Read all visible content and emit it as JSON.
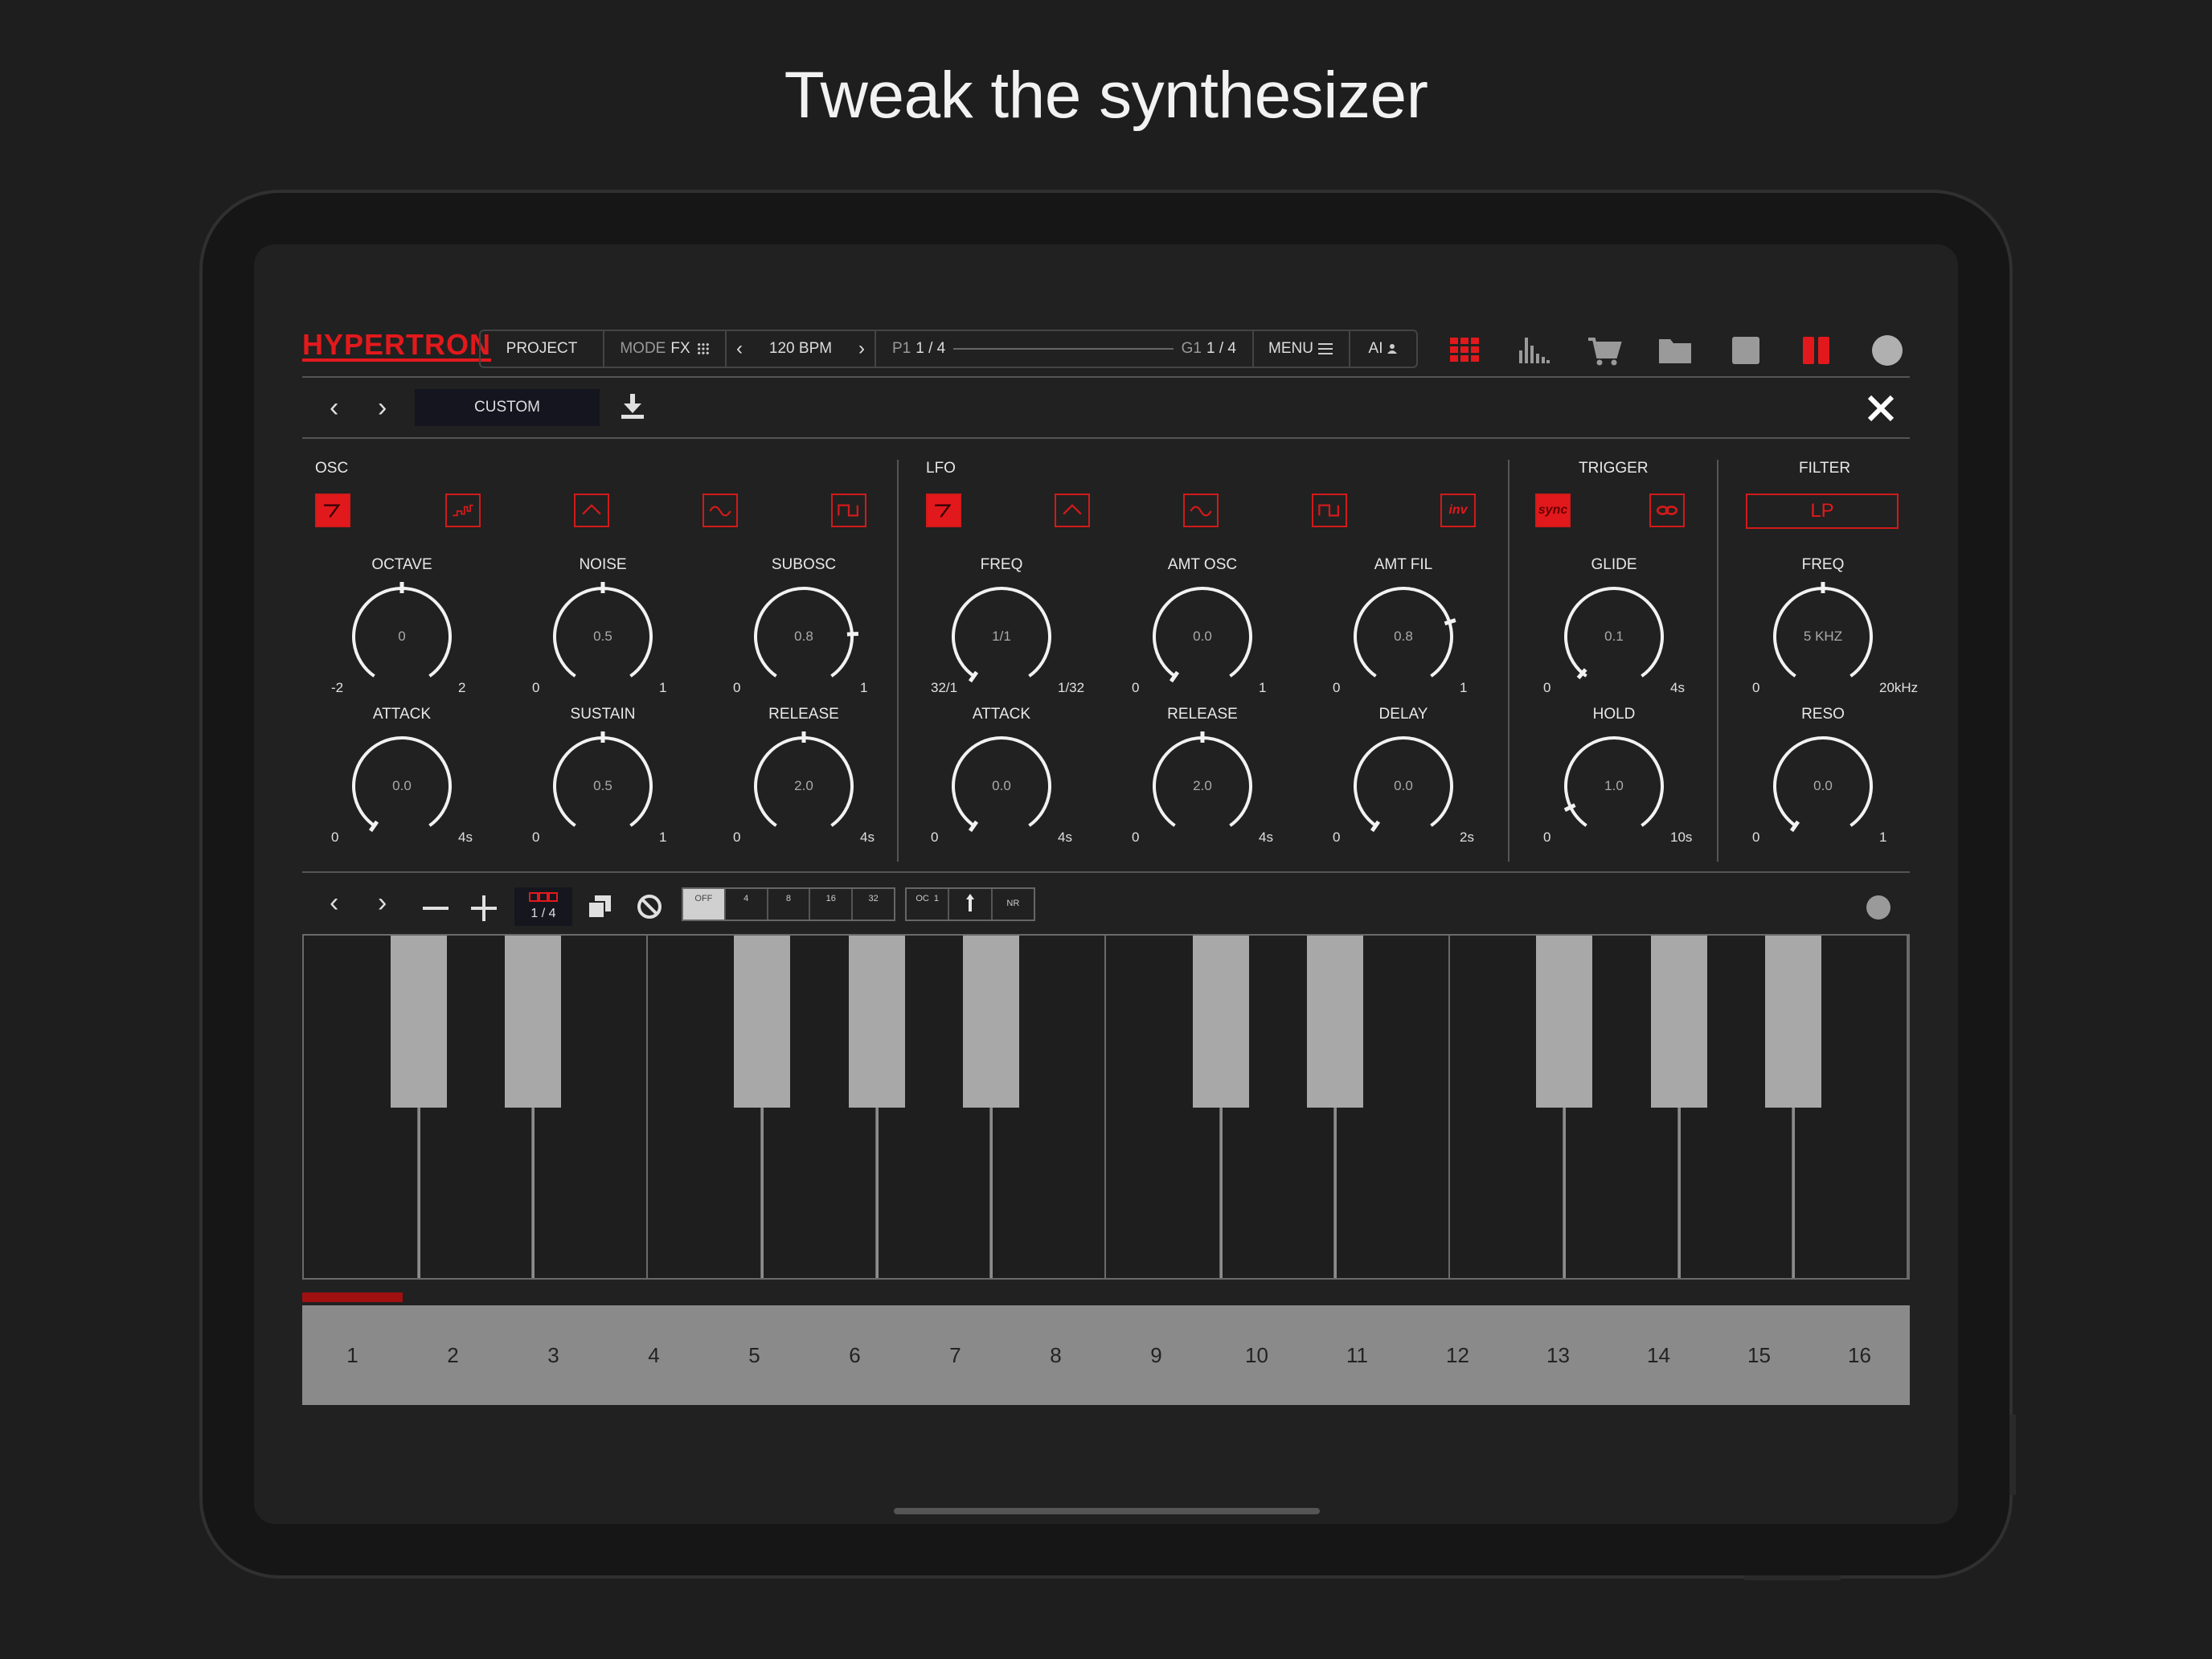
{
  "headline": "Tweak the synthesizer",
  "colors": {
    "accent": "#e2191c",
    "background": "#212121",
    "step_bar": "#8a8a8a",
    "black_key": "#a8a8a8"
  },
  "app": {
    "logo": "HYPERTRON"
  },
  "nav": {
    "project": "PROJECT",
    "mode_label": "MODE",
    "mode_value": "FX",
    "bpm": "120 BPM",
    "pattern_label": "P1",
    "pattern_value": "1 / 4",
    "group_label": "G1",
    "group_value": "1 / 4",
    "menu": "MENU",
    "ai": "AI"
  },
  "top_icons": [
    "grid-icon",
    "mixer-icon",
    "cart-icon",
    "folder-icon",
    "stop-icon",
    "pause-icon",
    "record-icon"
  ],
  "preset": {
    "name": "CUSTOM"
  },
  "sections": {
    "osc": "OSC",
    "lfo": "LFO",
    "trigger": "TRIGGER",
    "filter": "FILTER",
    "filter_type": "LP",
    "sync": "sync",
    "inv": "inv"
  },
  "knobs": [
    {
      "title": "OCTAVE",
      "value": "0",
      "min": "-2",
      "max": "2",
      "level": 0.5
    },
    {
      "title": "NOISE",
      "value": "0.5",
      "min": "0",
      "max": "1",
      "level": 0.5
    },
    {
      "title": "SUBOSC",
      "value": "0.8",
      "min": "0",
      "max": "1",
      "level": 0.8
    },
    {
      "title": "FREQ",
      "value": "1/1",
      "min": "32/1",
      "max": "1/32",
      "level": 0.0
    },
    {
      "title": "AMT OSC",
      "value": "0.0",
      "min": "0",
      "max": "1",
      "level": 0.0
    },
    {
      "title": "AMT FIL",
      "value": "0.8",
      "min": "0",
      "max": "1",
      "level": 0.75
    },
    {
      "title": "GLIDE",
      "value": "0.1",
      "min": "0",
      "max": "4s",
      "level": 0.02
    },
    {
      "title": "FREQ",
      "value": "5 KHZ",
      "min": "0",
      "max": "20kHz",
      "level": 0.5
    },
    {
      "title": "ATTACK",
      "value": "0.0",
      "min": "0",
      "max": "4s",
      "level": 0.0
    },
    {
      "title": "SUSTAIN",
      "value": "0.5",
      "min": "0",
      "max": "1",
      "level": 0.5
    },
    {
      "title": "RELEASE",
      "value": "2.0",
      "min": "0",
      "max": "4s",
      "level": 0.5
    },
    {
      "title": "ATTACK",
      "value": "0.0",
      "min": "0",
      "max": "4s",
      "level": 0.0
    },
    {
      "title": "RELEASE",
      "value": "2.0",
      "min": "0",
      "max": "4s",
      "level": 0.5
    },
    {
      "title": "DELAY",
      "value": "0.0",
      "min": "0",
      "max": "2s",
      "level": 0.0
    },
    {
      "title": "HOLD",
      "value": "1.0",
      "min": "0",
      "max": "10s",
      "level": 0.1
    },
    {
      "title": "RESO",
      "value": "0.0",
      "min": "0",
      "max": "1",
      "level": 0.0
    }
  ],
  "sequencer": {
    "page": "1 / 4",
    "resolution_options": [
      "OFF",
      "4",
      "8",
      "16",
      "32"
    ],
    "oc_label": "OC",
    "oc_value": "1",
    "nr_label": "NR",
    "steps": [
      "1",
      "2",
      "3",
      "4",
      "5",
      "6",
      "7",
      "8",
      "9",
      "10",
      "11",
      "12",
      "13",
      "14",
      "15",
      "16"
    ],
    "position": 0.0625
  }
}
